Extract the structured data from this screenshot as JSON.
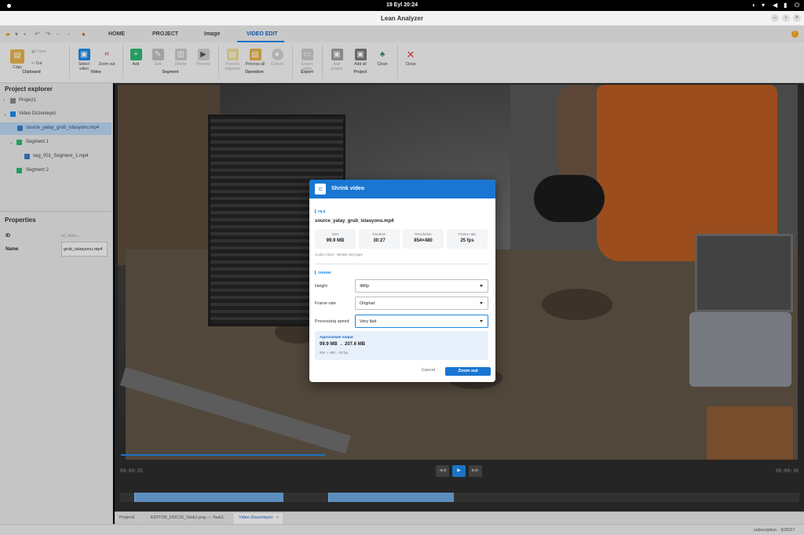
{
  "system": {
    "clock": "19 Eyl  20:24"
  },
  "window": {
    "title": "Lean Analyzer"
  },
  "ribbon_tabs": [
    "HOME",
    "PROJECT",
    "Image",
    "VIDEO EDIT"
  ],
  "ribbon": {
    "clipboard": {
      "copy": "Copy",
      "paste": "Paste",
      "cut": "Cut",
      "group": "Clipboard"
    },
    "video": {
      "select_video": "Select video",
      "zoom_out": "Zoom out",
      "group": "Video"
    },
    "segment": {
      "add": "Add",
      "edit": "Edit",
      "delete": "Delete",
      "preview": "Preview",
      "group": "Segment"
    },
    "operation": {
      "process_segment": "Process segment",
      "process_all": "Process all",
      "cancel": "Cancel",
      "group": "Operation"
    },
    "export": {
      "export_video": "Export video",
      "group": "Export"
    },
    "project": {
      "add_project": "Add project",
      "add_all": "Add all",
      "clean": "Clean",
      "group": "Project"
    },
    "close": {
      "close": "Close"
    }
  },
  "explorer": {
    "title": "Project explorer",
    "items": [
      {
        "label": "Project1"
      },
      {
        "label": "Video Düzenleyici"
      },
      {
        "label": "source_yatay_grub_istasyonu.mp4"
      },
      {
        "label": "Segment 1"
      },
      {
        "label": "seg_001_Segment_1.mp4"
      },
      {
        "label": "Segment 2"
      }
    ]
  },
  "properties": {
    "title": "Properties",
    "id_label": "ID",
    "id_value": "v0_fa0ec...",
    "name_label": "Name",
    "name_value": "grub_istasyonu.mp4"
  },
  "player": {
    "time_current": "00:00:25",
    "time_total": "00:00:30"
  },
  "doc_tabs": [
    "Project1",
    "EDITOR_DOC15_Task1.png — Task1",
    "Video Düzenleyici"
  ],
  "status": {
    "right": "subscription · 9/26/27"
  },
  "dialog": {
    "title": "Shrink video",
    "file_section": "FILE",
    "file_name": "source_yatay_grub_istasyonu.mp4",
    "stats": [
      {
        "label": "Size",
        "value": "99.9 MB"
      },
      {
        "label": "Duration",
        "value": "30:27"
      },
      {
        "label": "Resolution",
        "value": "854×480"
      },
      {
        "label": "Frame rate",
        "value": "25 fps"
      }
    ],
    "codec_info": "Codec h264 · Bitrate 446 kbps",
    "shrink_section": "SHRINK",
    "height_label": "Height",
    "height_value": "480p",
    "framerate_label": "Frame rate",
    "framerate_value": "Original",
    "speed_label": "Processing speed",
    "speed_value": "Very fast",
    "approx_label": "Approximate output",
    "approx_value": "99.9 MB  →  207.6 MB",
    "approx_detail": "854 × 480 · 25 fps",
    "cancel_label": "Cancel",
    "primary_label": "Zoom out"
  }
}
